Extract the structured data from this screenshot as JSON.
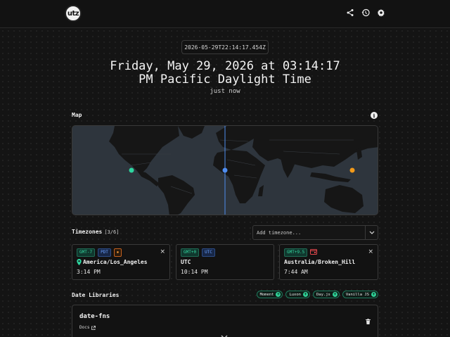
{
  "header": {
    "logo_text": "utz",
    "icons": [
      "share-icon",
      "history-icon",
      "settings-icon"
    ]
  },
  "clock": {
    "iso": "2026-05-29T22:14:17.454Z",
    "line1": "Friday, May 29, 2026 at 03:14:17",
    "line2": "PM Pacific Daylight Time",
    "relative": "just now"
  },
  "map_section": {
    "title": "Map",
    "info_icon": "info-icon",
    "markers": [
      {
        "zone": "America/Los_Angeles",
        "color": "#2ed6a0"
      },
      {
        "zone": "UTC",
        "color": "#4f8df0"
      },
      {
        "zone": "Australia/Broken_Hill",
        "color": "#f29a1a"
      }
    ]
  },
  "timezones": {
    "title": "Timezones",
    "count": "[3/6]",
    "placeholder": "Add timezone...",
    "cards": [
      {
        "offset": "GMT-7",
        "abbr": "PDT",
        "zone": "America/Los_Angeles",
        "time": "3:14 PM",
        "extra_icon": "sun-icon"
      },
      {
        "offset": "GMT+0",
        "abbr": "UTC",
        "zone": "UTC",
        "time": "10:14 PM"
      },
      {
        "offset": "GMT+9.5",
        "zone": "Australia/Broken_Hill",
        "time": "7:44 AM",
        "extra_icon": "calendar-icon"
      }
    ],
    "close_glyph": "×"
  },
  "libraries": {
    "title": "Date Libraries",
    "chips": [
      "Moment",
      "Luxon",
      "Day.js",
      "Vanilla JS"
    ],
    "current": {
      "name": "date-fns",
      "docs_label": "Docs"
    }
  },
  "colors": {
    "accent_green": "#2ed6a0",
    "accent_blue": "#4f8df0",
    "accent_orange": "#f29a1a",
    "bg": "#141414"
  }
}
